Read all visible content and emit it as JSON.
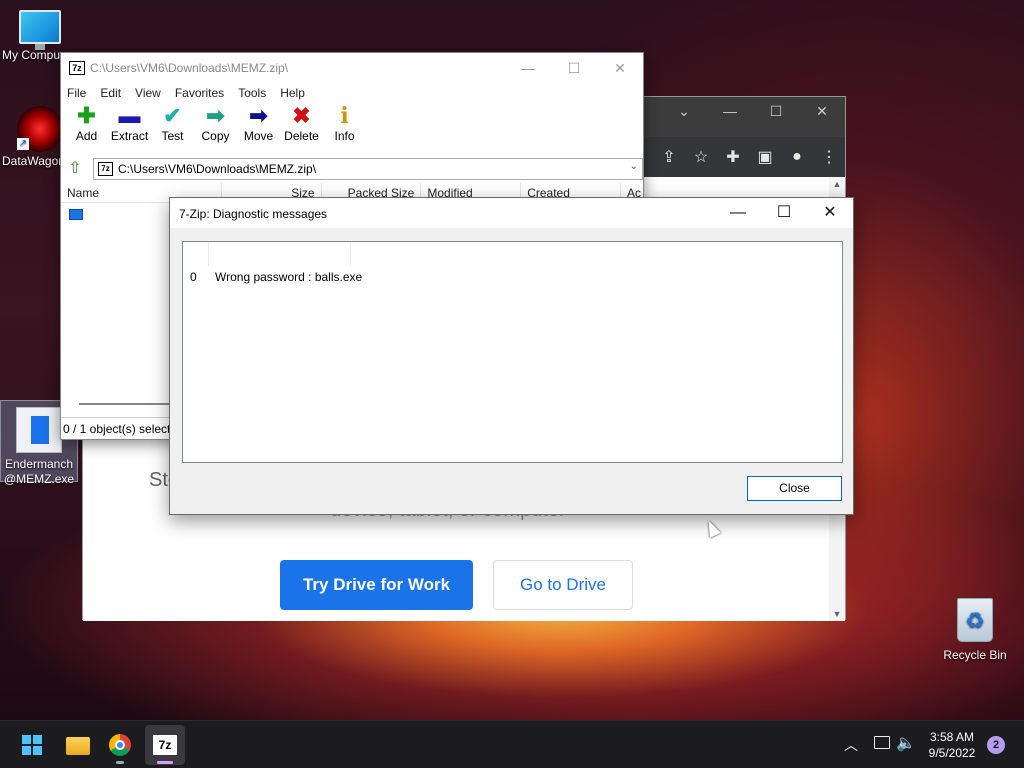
{
  "desktop": {
    "icons": [
      {
        "label": "My Compu"
      },
      {
        "label": "DataWagon"
      },
      {
        "label_line1": "Endermanch",
        "label_line2": "@MEMZ.exe"
      },
      {
        "label": "Recycle Bin"
      }
    ]
  },
  "chrome": {
    "bg_text_left": "Sto",
    "bg_text_sub": "device, tablet, or computer",
    "primary_button": "Try Drive for Work",
    "secondary_button": "Go to Drive"
  },
  "sevenzip": {
    "title": "C:\\Users\\VM6\\Downloads\\MEMZ.zip\\",
    "logo": "7z",
    "menu": [
      "File",
      "Edit",
      "View",
      "Favorites",
      "Tools",
      "Help"
    ],
    "toolbar": [
      {
        "label": "Add",
        "icon": "plus-icon",
        "glyph": "+",
        "color": "#1aa01a"
      },
      {
        "label": "Extract",
        "icon": "minus-icon",
        "glyph": "—",
        "color": "#1a1ab0"
      },
      {
        "label": "Test",
        "icon": "check-arrow-icon",
        "glyph": "▼",
        "color": "#20b0b0"
      },
      {
        "label": "Copy",
        "icon": "copy-arrow-icon",
        "glyph": "➡",
        "color": "#20a080"
      },
      {
        "label": "Move",
        "icon": "move-arrow-icon",
        "glyph": "➡",
        "color": "#10108a"
      },
      {
        "label": "Delete",
        "icon": "delete-x-icon",
        "glyph": "✖",
        "color": "#d01010"
      },
      {
        "label": "Info",
        "icon": "info-icon",
        "glyph": "i",
        "color": "#d0a000"
      }
    ],
    "address": "C:\\Users\\VM6\\Downloads\\MEMZ.zip\\",
    "columns": [
      "Name",
      "Size",
      "Packed Size",
      "Modified",
      "Created",
      "Ac"
    ],
    "status": "0 / 1 object(s) selecte"
  },
  "dialog": {
    "title": "7-Zip: Diagnostic messages",
    "messages": [
      {
        "index": "0",
        "text": "Wrong password : balls.exe"
      }
    ],
    "close_label": "Close"
  },
  "taskbar": {
    "time": "3:58 AM",
    "date": "9/5/2022",
    "notification_count": "2"
  }
}
